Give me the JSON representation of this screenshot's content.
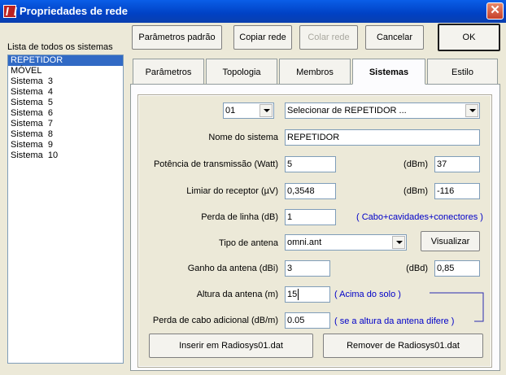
{
  "window": {
    "title": "Propriedades de rede",
    "close_label": "✕"
  },
  "toolbar": {
    "default_params": "Parâmetros padrão",
    "copy_network": "Copiar rede",
    "paste_network": "Colar rede",
    "cancel": "Cancelar",
    "ok": "OK"
  },
  "systems_list": {
    "label": "Lista de todos os sistemas",
    "items": [
      "REPETIDOR",
      "MÓVEL",
      "Sistema  3",
      "Sistema  4",
      "Sistema  5",
      "Sistema  6",
      "Sistema  7",
      "Sistema  8",
      "Sistema  9",
      "Sistema  10"
    ],
    "selected_index": 0
  },
  "tabs": [
    {
      "label": "Parâmetros"
    },
    {
      "label": "Topologia"
    },
    {
      "label": "Membros"
    },
    {
      "label": "Sistemas",
      "active": true
    },
    {
      "label": "Estilo"
    }
  ],
  "form": {
    "system_number": "01",
    "system_selector": "Selecionar de REPETIDOR ...",
    "system_name_label": "Nome do sistema",
    "system_name": "REPETIDOR",
    "tx_power_label": "Potência de transmissão (Watt)",
    "tx_power_watt": "5",
    "tx_power_dbm_label": "(dBm)",
    "tx_power_dbm": "37",
    "rx_threshold_label": "Limiar do receptor (µV)",
    "rx_threshold_uv": "0,3548",
    "rx_threshold_dbm_label": "(dBm)",
    "rx_threshold_dbm": "-116",
    "line_loss_label": "Perda de linha (dB)",
    "line_loss": "1",
    "line_loss_note": "( Cabo+cavidades+conectores )",
    "antenna_type_label": "Tipo de antena",
    "antenna_type": "omni.ant",
    "view_button": "Visualizar",
    "antenna_gain_label": "Ganho da antena (dBi)",
    "antenna_gain_dbi": "3",
    "antenna_gain_dbd_label": "(dBd)",
    "antenna_gain_dbd": "0,85",
    "antenna_height_label": "Altura da antena (m)",
    "antenna_height": "15",
    "antenna_height_note": "( Acima do solo )",
    "cable_loss_label": "Perda de cabo adicional (dB/m)",
    "cable_loss": "0.05",
    "cable_loss_note": "( se a altura da antena difere )",
    "insert_button": "Inserir em Radiosys01.dat",
    "remove_button": "Remover de Radiosys01.dat"
  },
  "colors": {
    "titlebar": "#0041c4",
    "selection": "#316ac5",
    "note_text": "#0000c8",
    "face": "#ece9d8"
  }
}
